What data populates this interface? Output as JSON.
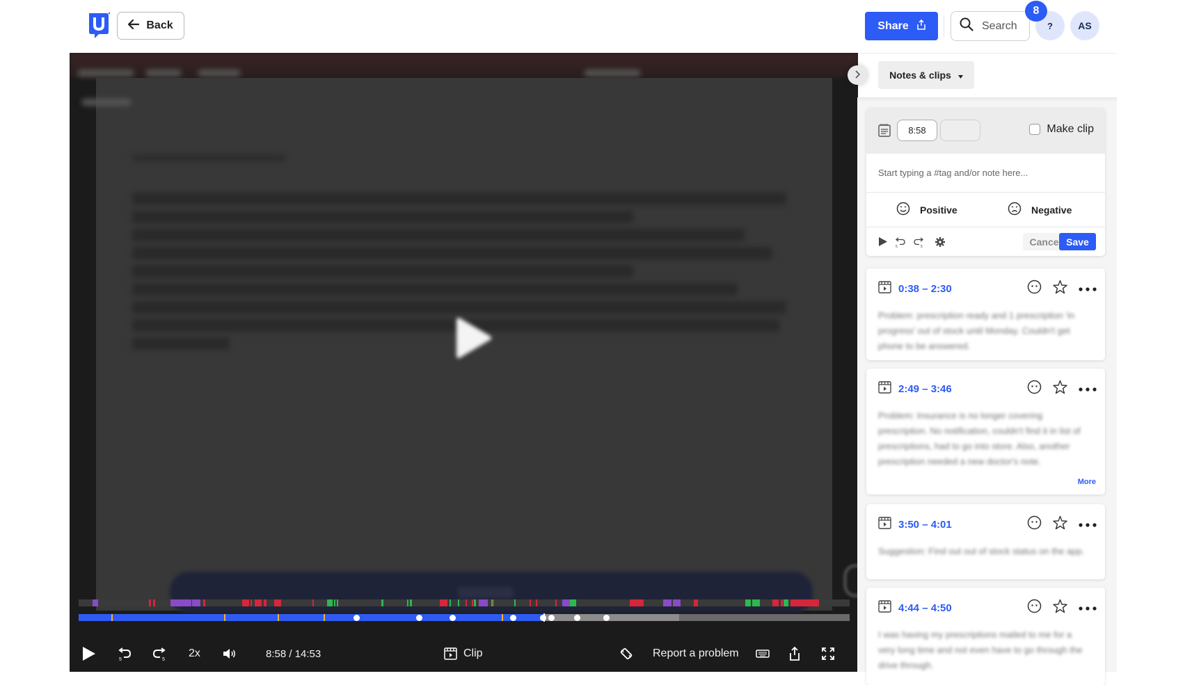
{
  "header": {
    "logo_letter": "U",
    "back_label": "Back",
    "share_label": "Share",
    "search_label": "Search",
    "help_label": "?",
    "notification_count": "8",
    "avatar_initials": "AS"
  },
  "colors": {
    "brand_blue": "#2c5bf6",
    "tag_red": "#d6263a",
    "tag_purple": "#8a4bc6",
    "tag_green": "#2eb84f",
    "marker_orange": "#f2b035"
  },
  "video": {
    "current_time": "8:58",
    "duration": "14:53",
    "time_display": "8:58 / 14:53",
    "progress_fraction": 0.603,
    "buffered_fraction": 0.779,
    "speed_label": "2x",
    "clip_label": "Clip",
    "report_label": "Report a problem",
    "tag_segments": [
      {
        "start": 0.018,
        "end": 0.025,
        "type": "purple"
      },
      {
        "start": 0.091,
        "end": 0.094,
        "type": "red"
      },
      {
        "start": 0.097,
        "end": 0.099,
        "type": "red"
      },
      {
        "start": 0.119,
        "end": 0.146,
        "type": "purple"
      },
      {
        "start": 0.147,
        "end": 0.158,
        "type": "purple"
      },
      {
        "start": 0.162,
        "end": 0.164,
        "type": "red"
      },
      {
        "start": 0.212,
        "end": 0.221,
        "type": "red"
      },
      {
        "start": 0.223,
        "end": 0.225,
        "type": "red"
      },
      {
        "start": 0.228,
        "end": 0.237,
        "type": "red"
      },
      {
        "start": 0.24,
        "end": 0.244,
        "type": "red"
      },
      {
        "start": 0.254,
        "end": 0.263,
        "type": "red"
      },
      {
        "start": 0.303,
        "end": 0.305,
        "type": "red"
      },
      {
        "start": 0.322,
        "end": 0.329,
        "type": "green"
      },
      {
        "start": 0.331,
        "end": 0.333,
        "type": "green"
      },
      {
        "start": 0.335,
        "end": 0.337,
        "type": "green"
      },
      {
        "start": 0.393,
        "end": 0.395,
        "type": "green"
      },
      {
        "start": 0.426,
        "end": 0.428,
        "type": "green"
      },
      {
        "start": 0.43,
        "end": 0.432,
        "type": "green"
      },
      {
        "start": 0.468,
        "end": 0.478,
        "type": "red"
      },
      {
        "start": 0.481,
        "end": 0.483,
        "type": "green"
      },
      {
        "start": 0.492,
        "end": 0.494,
        "type": "green"
      },
      {
        "start": 0.502,
        "end": 0.504,
        "type": "red"
      },
      {
        "start": 0.51,
        "end": 0.512,
        "type": "red"
      },
      {
        "start": 0.513,
        "end": 0.515,
        "type": "green"
      },
      {
        "start": 0.519,
        "end": 0.531,
        "type": "purple"
      },
      {
        "start": 0.535,
        "end": 0.537,
        "type": "green"
      },
      {
        "start": 0.537,
        "end": 0.539,
        "type": "red"
      },
      {
        "start": 0.565,
        "end": 0.567,
        "type": "green"
      },
      {
        "start": 0.585,
        "end": 0.587,
        "type": "red"
      },
      {
        "start": 0.593,
        "end": 0.595,
        "type": "red"
      },
      {
        "start": 0.618,
        "end": 0.62,
        "type": "red"
      },
      {
        "start": 0.627,
        "end": 0.637,
        "type": "purple"
      },
      {
        "start": 0.637,
        "end": 0.645,
        "type": "green"
      },
      {
        "start": 0.715,
        "end": 0.717,
        "type": "red"
      },
      {
        "start": 0.717,
        "end": 0.733,
        "type": "red"
      },
      {
        "start": 0.758,
        "end": 0.769,
        "type": "purple"
      },
      {
        "start": 0.771,
        "end": 0.781,
        "type": "purple"
      },
      {
        "start": 0.798,
        "end": 0.803,
        "type": "red"
      },
      {
        "start": 0.865,
        "end": 0.872,
        "type": "green"
      },
      {
        "start": 0.874,
        "end": 0.884,
        "type": "green"
      },
      {
        "start": 0.9,
        "end": 0.908,
        "type": "red"
      },
      {
        "start": 0.911,
        "end": 0.913,
        "type": "red"
      },
      {
        "start": 0.914,
        "end": 0.921,
        "type": "green"
      },
      {
        "start": 0.923,
        "end": 0.96,
        "type": "red"
      }
    ],
    "clip_markers": [
      0.042,
      0.189,
      0.258,
      0.318,
      0.549,
      0.646
    ],
    "note_dots": [
      0.36,
      0.441,
      0.485,
      0.563,
      0.602,
      0.613,
      0.646,
      0.684
    ]
  },
  "panel": {
    "view_label": "Notes & clips",
    "composer": {
      "start_time": "8:58",
      "end_time": "",
      "make_clip_label": "Make clip",
      "make_clip_checked": false,
      "note_placeholder": "Start typing a #tag and/or note here...",
      "positive_label": "Positive",
      "negative_label": "Negative",
      "cancel_label": "Cancel",
      "save_label": "Save"
    },
    "clips": [
      {
        "time": "0:38 – 2:30",
        "text": "Problem: prescription ready and 1 prescription 'in progress' out of stock until Monday. Couldn't get phone to be answered.",
        "more": ""
      },
      {
        "time": "2:49 – 3:46",
        "text": "Problem: Insurance is no longer covering prescription. No notification, couldn't find it in list of prescriptions, had to go into store. Also, another prescription needed a new doctor's note.",
        "more": "More"
      },
      {
        "time": "3:50 – 4:01",
        "text": "Suggestion: Find out out of stock status on the app.",
        "more": ""
      },
      {
        "time": "4:44 – 4:50",
        "text": "I was having my prescriptions mailed to me for a very long time and not even have to go through the drive through.",
        "more": ""
      }
    ]
  }
}
